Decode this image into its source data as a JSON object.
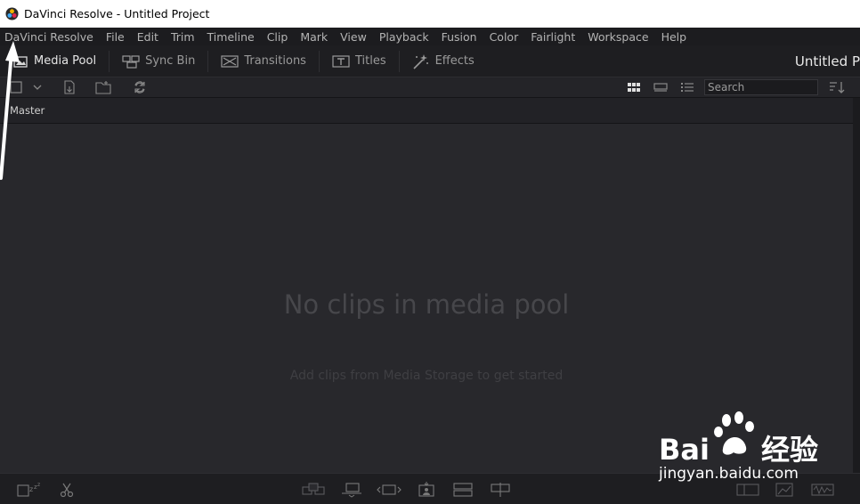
{
  "window": {
    "title": "DaVinci Resolve - Untitled Project"
  },
  "menu": [
    "DaVinci Resolve",
    "File",
    "Edit",
    "Trim",
    "Timeline",
    "Clip",
    "Mark",
    "View",
    "Playback",
    "Fusion",
    "Color",
    "Fairlight",
    "Workspace",
    "Help"
  ],
  "toolbar": {
    "media_pool": "Media Pool",
    "sync_bin": "Sync Bin",
    "transitions": "Transitions",
    "titles": "Titles",
    "effects": "Effects",
    "project_title": "Untitled P"
  },
  "search": {
    "placeholder": "Search"
  },
  "bin": {
    "name": "Master"
  },
  "empty_state": {
    "title": "No clips in media pool",
    "subtitle": "Add clips from Media Storage to get started"
  },
  "watermark": {
    "brand": "Bai",
    "brand_cn": "经验",
    "url": "jingyan.baidu.com"
  }
}
